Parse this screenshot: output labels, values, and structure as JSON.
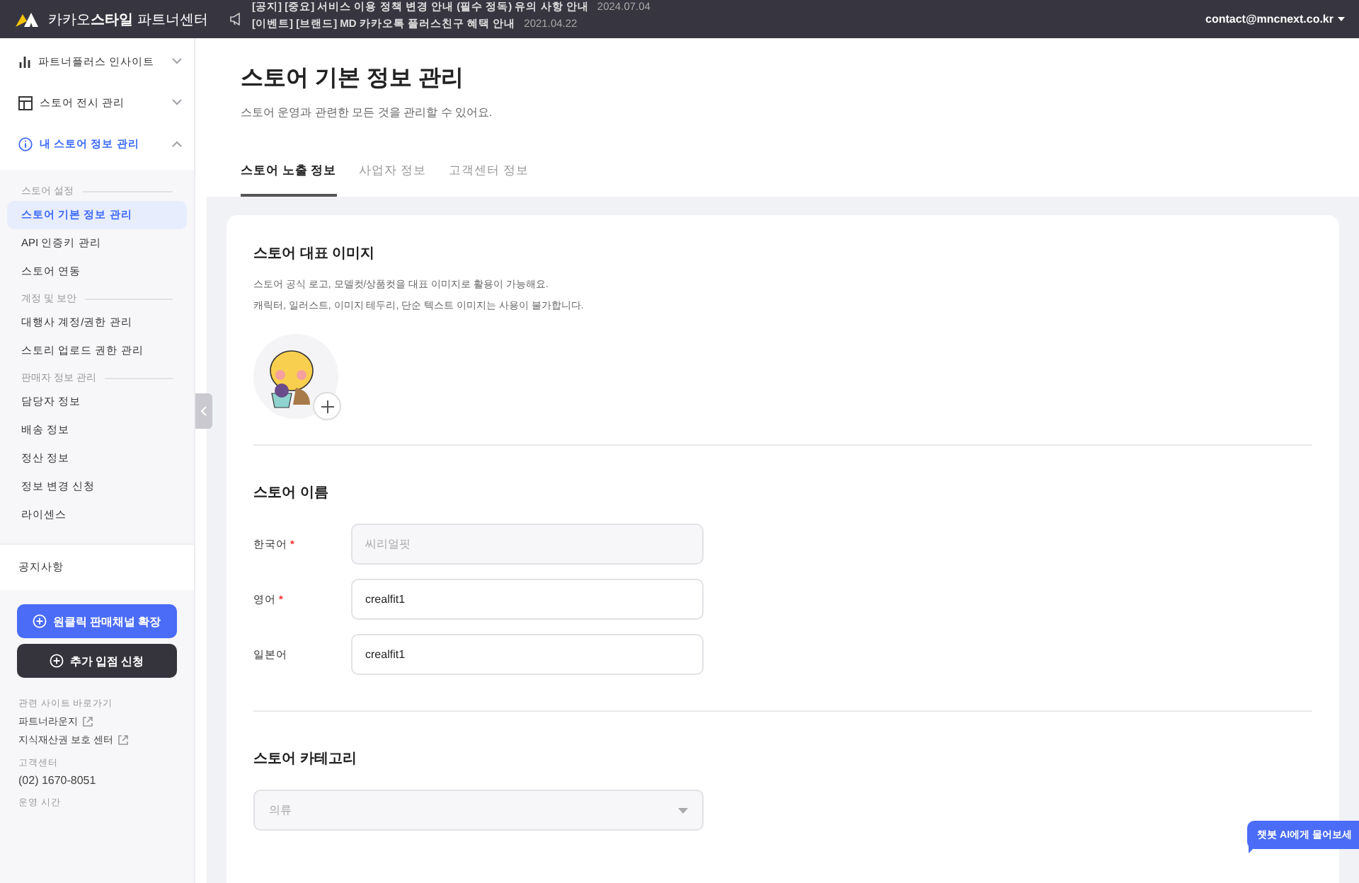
{
  "top_bar": {
    "logo_text": "카카오**스타일** 파트너센터",
    "notices": [
      {
        "text": "[공지] [중요] 서비스 이용 정책 변경 안내 (필수 정독) 유의 사항 안내",
        "date": "2024.07.04"
      },
      {
        "text": "[이벤트] [브랜드] MD 카카오톡 플러스친구 혜택 안내",
        "date": "2021.04.22"
      }
    ],
    "account": "contact@mncnext.co.kr"
  },
  "sidebar": {
    "menus": [
      {
        "kind": "chart",
        "label": "파트너플러스 인사이트",
        "expanded": false,
        "selected": false
      },
      {
        "kind": "layout",
        "label": "스토어 전시 관리",
        "expanded": false,
        "selected": false
      },
      {
        "kind": "info",
        "label": "내 스토어 정보 관리",
        "expanded": true,
        "selected": true
      }
    ],
    "groups": [
      {
        "title": "스토어 설정",
        "items": [
          {
            "label": "스토어 기본 정보 관리",
            "selected": true
          },
          {
            "label": "API 인증키 관리",
            "selected": false
          },
          {
            "label": "스토어 연동",
            "selected": false
          }
        ]
      },
      {
        "title": "계정 및 보안",
        "items": [
          {
            "label": "대행사 계정/권한 관리",
            "selected": false
          },
          {
            "label": "스토리 업로드 권한 관리",
            "selected": false
          }
        ]
      },
      {
        "title": "판매자 정보 관리",
        "items": [
          {
            "label": "담당자 정보",
            "selected": false
          },
          {
            "label": "배송 정보",
            "selected": false
          },
          {
            "label": "정산 정보",
            "selected": false
          },
          {
            "label": "정보 변경 신청",
            "selected": false
          },
          {
            "label": "라이센스",
            "selected": false
          }
        ]
      }
    ],
    "notice_link": "공지사항",
    "buttons": [
      {
        "kind": "primary",
        "label": "원클릭 판매채널 확장"
      },
      {
        "kind": "dark",
        "label": "추가 입점 신청"
      }
    ],
    "related": {
      "title": "관련 사이트 바로가기",
      "links": [
        "파트너라운지",
        "지식재산권 보호 센터"
      ]
    },
    "support": {
      "title": "고객센터",
      "phone": "(02) 1670-8051"
    },
    "hours_title": "운영 시간"
  },
  "main": {
    "title": "스토어 기본 정보 관리",
    "subtitle": "스토어 운영과 관련한 모든 것을 관리할 수 있어요.",
    "tabs": [
      {
        "label": "스토어 노출 정보",
        "selected": true
      },
      {
        "label": "사업자 정보",
        "selected": false
      },
      {
        "label": "고객센터 정보",
        "selected": false
      }
    ],
    "image_section": {
      "title": "스토어 대표 이미지",
      "descriptions": [
        "스토어 공식 로고, 모델컷/상품컷을 대표 이미지로 활용이 가능해요.",
        "캐릭터, 일러스트, 이미지 테두리, 단순 텍스트 이미지는 사용이 불가합니다."
      ]
    },
    "name_section": {
      "title": "스토어 이름",
      "fields": [
        {
          "label": "한국어",
          "required_mark": "*",
          "value": "씨리얼핏",
          "disabled": true
        },
        {
          "label": "영어",
          "required_mark": "*",
          "value": "crealfit1",
          "disabled": false
        },
        {
          "label": "일본어",
          "value": "crealfit1",
          "disabled": false
        }
      ]
    },
    "category_section": {
      "title": "스토어 카테고리",
      "select": {
        "value": "의류",
        "disabled": true
      }
    },
    "chat_button": "챗봇 AI에게 물어보세"
  }
}
